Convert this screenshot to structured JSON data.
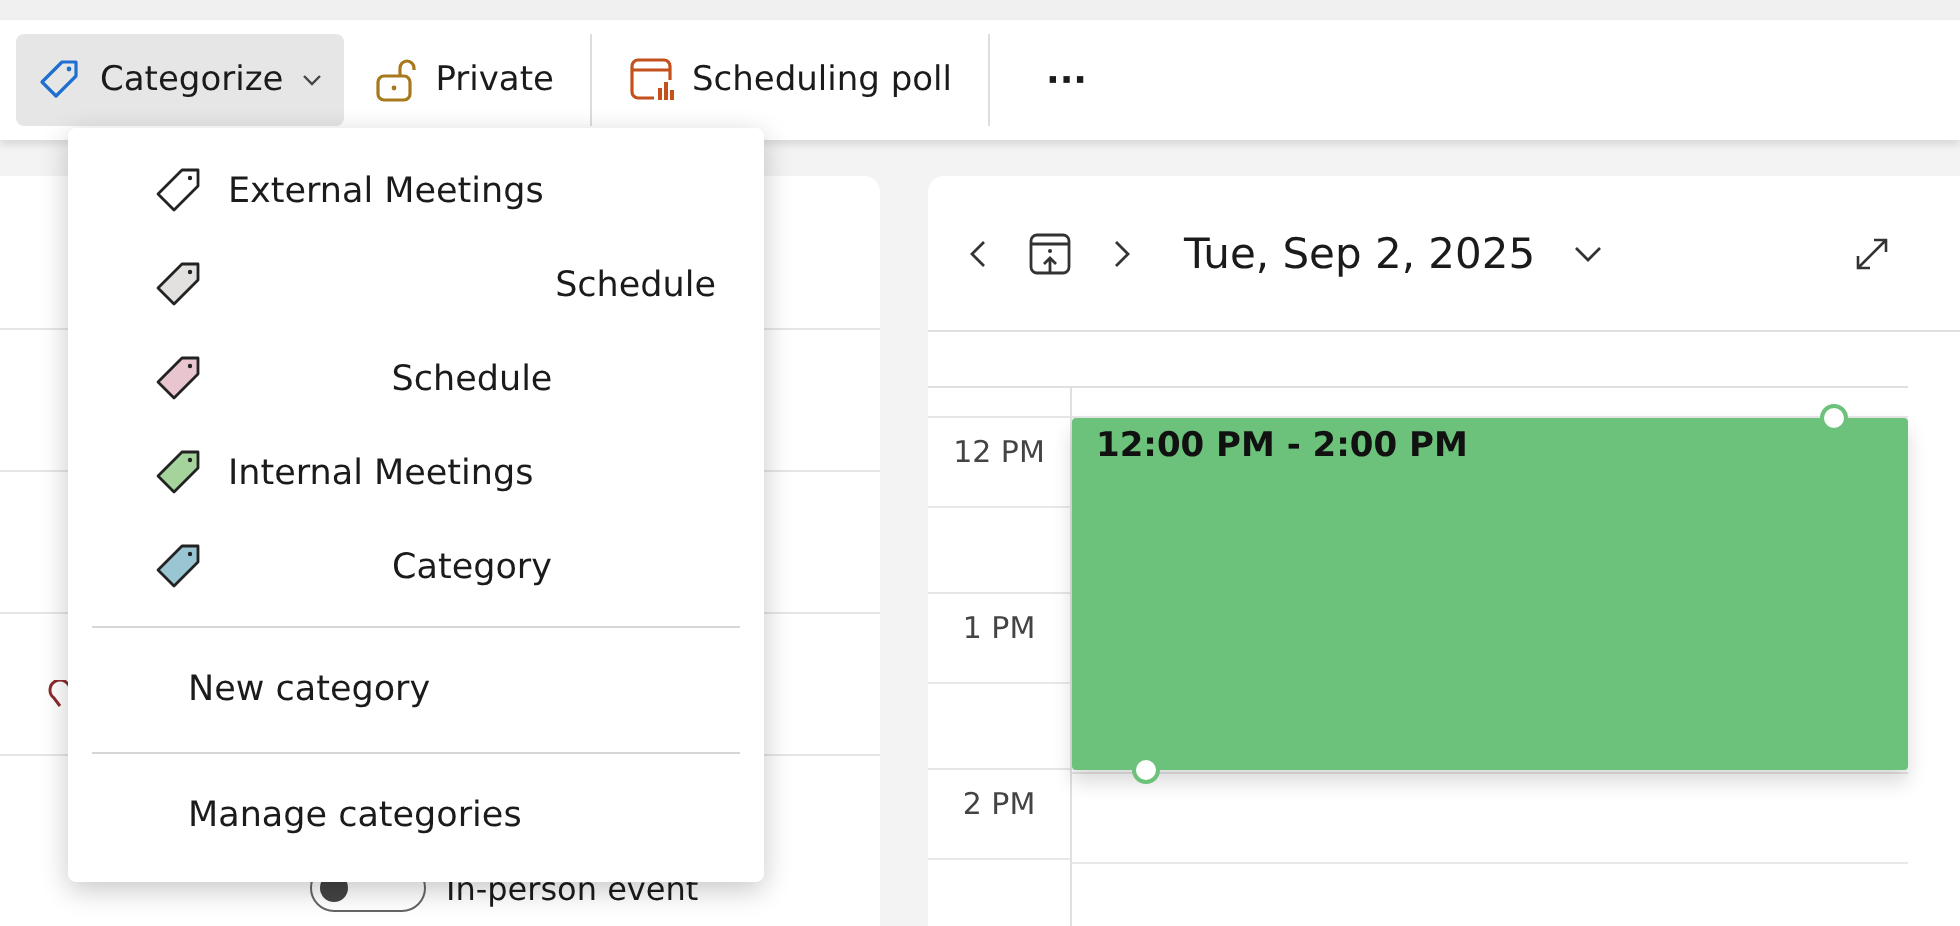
{
  "toolbar": {
    "buttons": [
      {
        "kind": "categorize",
        "label": "Categorize",
        "selected": true
      },
      {
        "kind": "private",
        "label": "Private",
        "selected": false
      },
      {
        "kind": "poll",
        "label": "Scheduling poll",
        "selected": false
      },
      {
        "kind": "more",
        "label": "···",
        "selected": false
      }
    ]
  },
  "category_menu": {
    "categories": [
      {
        "label": "External Meetings",
        "kind": "left"
      },
      {
        "label": "Schedule",
        "color": "#e3e1df",
        "kind": "right"
      },
      {
        "label": "Schedule",
        "color": "#e9c6cf",
        "kind": "center"
      },
      {
        "label": "Internal Meetings",
        "color": "#a4d39c",
        "kind": "left"
      },
      {
        "label": "Category",
        "color": "#9ac6d3",
        "kind": "center"
      }
    ],
    "actions": [
      "New category",
      "Manage categories"
    ]
  },
  "form": {
    "in_person_toggle": {
      "label": "In-person event",
      "on": false
    }
  },
  "calendar": {
    "date": "Tue, Sep 2, 2025",
    "hours": [
      "12 PM",
      "1 PM",
      "2 PM"
    ],
    "event": {
      "time": "12:00 PM - 2:00 PM",
      "color": "#6cc27a"
    }
  }
}
